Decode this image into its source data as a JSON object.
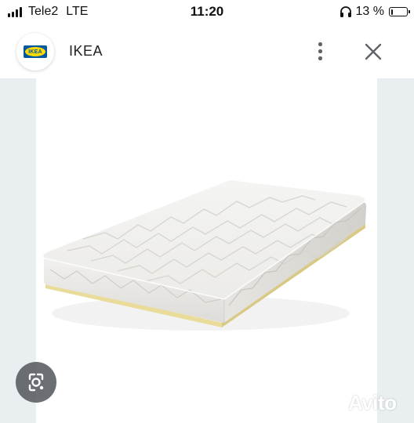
{
  "status_bar": {
    "carrier": "Tele2",
    "network": "LTE",
    "time": "11:20",
    "battery_text": "13 %",
    "battery_level": 0.13,
    "icons": [
      "signal-icon",
      "headphones-icon",
      "battery-icon"
    ]
  },
  "header": {
    "site_logo": "IKEA",
    "site_name": "IKEA",
    "icons": [
      "more-vertical-icon",
      "close-icon"
    ]
  },
  "image": {
    "subject": "mattress",
    "icons": [
      "google-lens-icon"
    ]
  },
  "watermark": {
    "text": "Avito"
  },
  "colors": {
    "side_panel": "#e9eef1",
    "ikea_blue": "#0058a3",
    "ikea_yellow": "#ffdb00",
    "lens_button": "#5f6368"
  }
}
